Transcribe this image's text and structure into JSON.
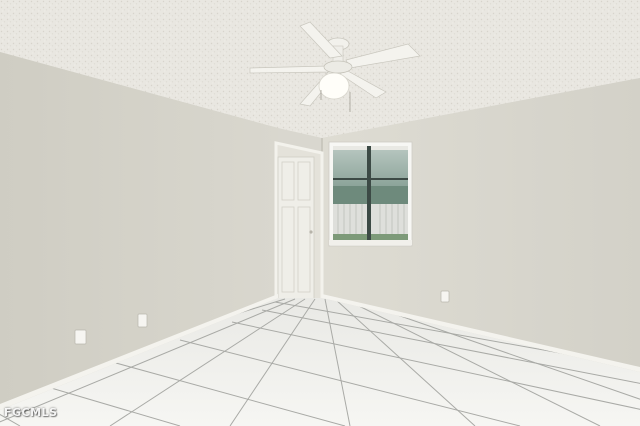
{
  "photo": {
    "watermark": "FGCMLS",
    "subject_icons": [
      "ceiling-fan-icon",
      "window-icon",
      "door-icon"
    ],
    "colors": {
      "ceiling": "#e9e7e1",
      "wall_left": "#d6d4cb",
      "wall_right": "#dddbd2",
      "floor_tile": "#f2f2ef",
      "grout": "#a9aaa6",
      "baseboard": "#f4f3ee",
      "window_frame": "#fafaf8",
      "window_glass": "#8fa79e"
    }
  }
}
